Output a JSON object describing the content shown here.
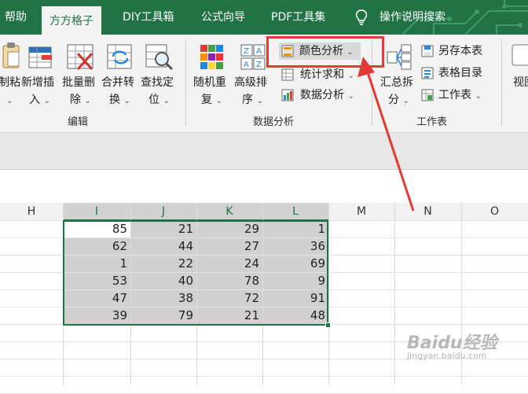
{
  "tabs": [
    {
      "label": "帮助",
      "active": false
    },
    {
      "label": "方方格子",
      "active": true
    },
    {
      "label": "DIY工具箱",
      "active": false
    },
    {
      "label": "公式向导",
      "active": false
    },
    {
      "label": "PDF工具集",
      "active": false
    }
  ],
  "search": {
    "label": "操作说明搜索"
  },
  "ribbon": {
    "edit_group": {
      "label": "编辑",
      "buttons": [
        {
          "line1": "制粘",
          "line2": "贴"
        },
        {
          "line1": "新增插",
          "line2": "入"
        },
        {
          "line1": "批量删",
          "line2": "除"
        },
        {
          "line1": "合并转",
          "line2": "换"
        },
        {
          "line1": "查找定",
          "line2": "位"
        }
      ]
    },
    "data_group": {
      "label": "数据分析",
      "buttons": [
        {
          "line1": "随机重",
          "line2": "复"
        },
        {
          "line1": "高级排",
          "line2": "序"
        }
      ],
      "small": [
        "颜色分析",
        "统计求和",
        "数据分析"
      ]
    },
    "sheet_group": {
      "label": "工作表",
      "summary": {
        "line1": "汇总拆",
        "line2": "分"
      },
      "small": [
        "另存本表",
        "表格目录",
        "工作表"
      ]
    },
    "view": {
      "line1": "视图"
    }
  },
  "sheet": {
    "columns": [
      "H",
      "I",
      "J",
      "K",
      "L",
      "M",
      "N",
      "O"
    ],
    "selected_columns": [
      "I",
      "J",
      "K",
      "L"
    ],
    "rows": [
      [
        85,
        21,
        29,
        1
      ],
      [
        62,
        44,
        27,
        36
      ],
      [
        1,
        22,
        24,
        69
      ],
      [
        53,
        40,
        78,
        9
      ],
      [
        47,
        38,
        72,
        91
      ],
      [
        39,
        79,
        21,
        48
      ]
    ]
  },
  "colors": {
    "accent": "#217346",
    "annotation": "#E53935",
    "selection_fill": "#D0D0D0"
  },
  "watermark": {
    "line1": "Baidu经验",
    "line2": "jingyan.baidu.com"
  }
}
